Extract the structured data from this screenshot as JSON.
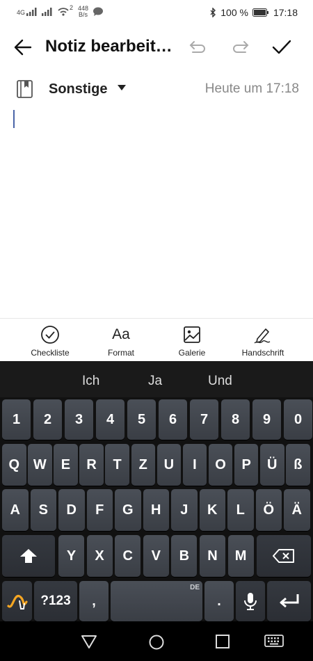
{
  "status_bar": {
    "signal1": "4G",
    "data_rate_value": "448",
    "data_rate_unit": "B/s",
    "wifi_badge": "2",
    "battery_percent": "100 %",
    "time": "17:18"
  },
  "app_bar": {
    "title": "Notiz bearbeit…"
  },
  "note_meta": {
    "category": "Sonstige",
    "timestamp": "Heute um 17:18"
  },
  "toolbar": {
    "checklist_label": "Checkliste",
    "format_label": "Format",
    "format_icon_text": "Aa",
    "gallery_label": "Galerie",
    "handwriting_label": "Handschrift"
  },
  "keyboard": {
    "suggestions": [
      "Ich",
      "Ja",
      "Und"
    ],
    "row_numbers": [
      "1",
      "2",
      "3",
      "4",
      "5",
      "6",
      "7",
      "8",
      "9",
      "0"
    ],
    "row_q": [
      "Q",
      "W",
      "E",
      "R",
      "T",
      "Z",
      "U",
      "I",
      "O",
      "P",
      "Ü",
      "ß"
    ],
    "row_a": [
      "A",
      "S",
      "D",
      "F",
      "G",
      "H",
      "J",
      "K",
      "L",
      "Ö",
      "Ä"
    ],
    "row_y": [
      "Y",
      "X",
      "C",
      "V",
      "B",
      "N",
      "M"
    ],
    "symbols_label": "?123",
    "comma_label": ",",
    "period_label": ".",
    "space_lang": "DE"
  }
}
